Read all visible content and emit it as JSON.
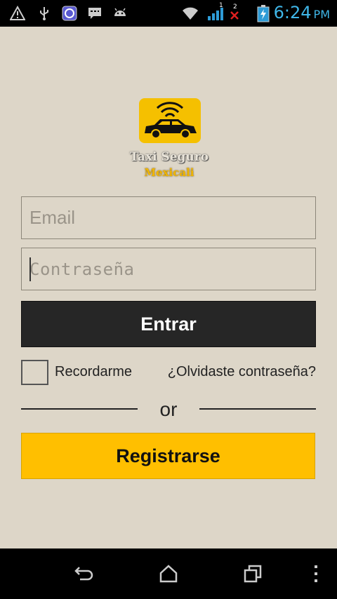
{
  "status_bar": {
    "time": "6:24",
    "ampm": "PM",
    "signal_sim1": "1",
    "signal_sim2": "2",
    "icons": [
      "warning-icon",
      "usb-icon",
      "app-notification-icon",
      "chat-icon",
      "android-icon",
      "wifi-icon",
      "signal-icon",
      "no-signal-icon",
      "battery-charging-icon"
    ]
  },
  "logo": {
    "line1": "Taxi Seguro",
    "line2": "Mexicali"
  },
  "form": {
    "email_placeholder": "Email",
    "password_placeholder": "Contraseña",
    "login_label": "Entrar",
    "remember_label": "Recordarme",
    "forgot_label": "¿Olvidaste contraseña?",
    "divider_text": "or",
    "register_label": "Registrarse"
  },
  "nav_bar": {
    "icons": [
      "back-icon",
      "home-icon",
      "recents-icon",
      "menu-icon"
    ]
  },
  "colors": {
    "background": "#ddd6c8",
    "login_button": "#262626",
    "register_button": "#ffbf00",
    "clock": "#3fb6e8"
  }
}
